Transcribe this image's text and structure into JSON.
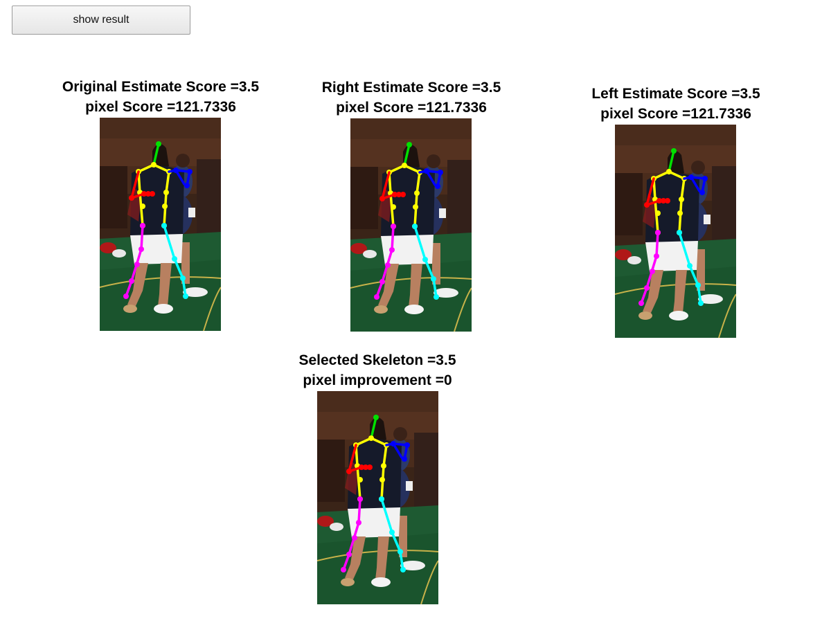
{
  "toolbar": {
    "show_result_label": "show result"
  },
  "panels": [
    {
      "id": "original",
      "title_line1": "Original Estimate Score =3.5",
      "title_line2": "pixel Score =121.7336"
    },
    {
      "id": "right",
      "title_line1": "Right Estimate Score =3.5",
      "title_line2": "pixel Score =121.7336"
    },
    {
      "id": "left",
      "title_line1": "Left Estimate Score =3.5",
      "title_line2": "pixel Score =121.7336"
    },
    {
      "id": "selected",
      "title_line1": "Selected Skeleton =3.5",
      "title_line2": "pixel improvement =0"
    }
  ],
  "skeleton_colors": {
    "head": "#00e000",
    "torso": "#ffff00",
    "right_arm": "#ff0000",
    "left_arm": "#0000ff",
    "right_leg": "#ff00ff",
    "left_leg": "#00ffff"
  },
  "scene_colors": {
    "floor": "#1e5a32",
    "court_line": "#c8b24a",
    "shirt": "#151a2a",
    "shorts": "#f2f2f2",
    "skin": "#b88060"
  }
}
